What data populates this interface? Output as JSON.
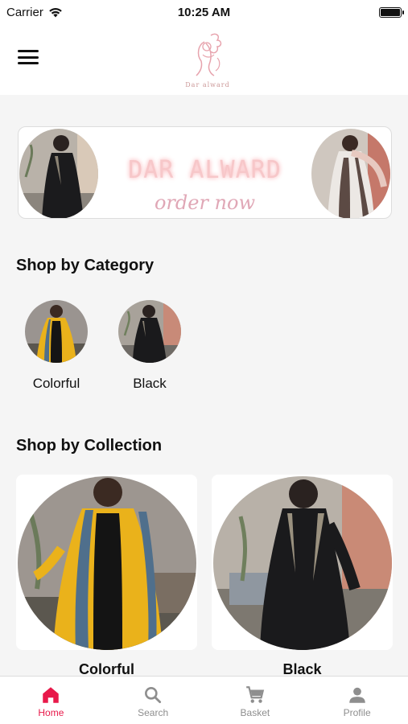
{
  "status_bar": {
    "carrier": "Carrier",
    "time": "10:25 AM",
    "battery_level": 1.0
  },
  "header": {
    "logo_text": "Dar alward"
  },
  "banner": {
    "title": "DAR ALWARD",
    "subtitle": "order now"
  },
  "category_section": {
    "title": "Shop by Category",
    "items": [
      {
        "label": "Colorful"
      },
      {
        "label": "Black"
      }
    ]
  },
  "collection_section": {
    "title": "Shop by Collection",
    "items": [
      {
        "label": "Colorful"
      },
      {
        "label": "Black"
      }
    ]
  },
  "tabbar": {
    "active": "Home",
    "items": [
      {
        "label": "Home",
        "icon": "home-icon"
      },
      {
        "label": "Search",
        "icon": "search-icon"
      },
      {
        "label": "Basket",
        "icon": "cart-icon"
      },
      {
        "label": "Profile",
        "icon": "profile-icon"
      }
    ]
  },
  "colors": {
    "accent": "#e8194a",
    "inactive": "#8e8e8e",
    "background": "#f5f5f5"
  }
}
